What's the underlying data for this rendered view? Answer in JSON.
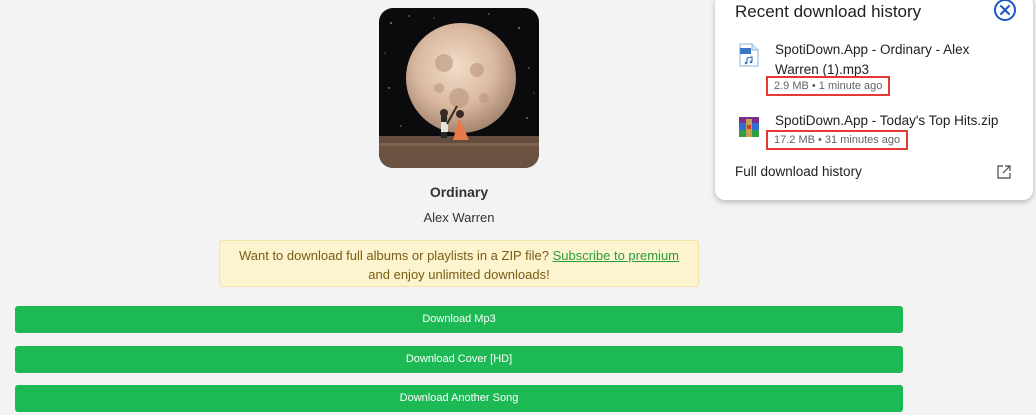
{
  "track": {
    "title": "Ordinary",
    "artist": "Alex Warren"
  },
  "promo": {
    "text_before": "Want to download full albums or playlists in a ZIP file? ",
    "link": "Subscribe to premium",
    "text_after": "and enjoy unlimited downloads!"
  },
  "buttons": {
    "download_mp3": "Download Mp3",
    "download_cover": "Download Cover [HD]",
    "download_another": "Download Another Song"
  },
  "history": {
    "title": "Recent download history",
    "items": [
      {
        "icon": "mp3-file-icon",
        "name": "SpotiDown.App - Ordinary - Alex Warren (1).mp3",
        "meta": "2.9 MB • 1 minute ago"
      },
      {
        "icon": "zip-archive-icon",
        "name": "SpotiDown.App - Today's Top Hits.zip",
        "meta": "17.2 MB • 31 minutes ago"
      }
    ],
    "full_history": "Full download history"
  },
  "colors": {
    "accent_green": "#1db954",
    "promo_bg": "#fcf3cf",
    "highlight_red": "#e53935"
  }
}
